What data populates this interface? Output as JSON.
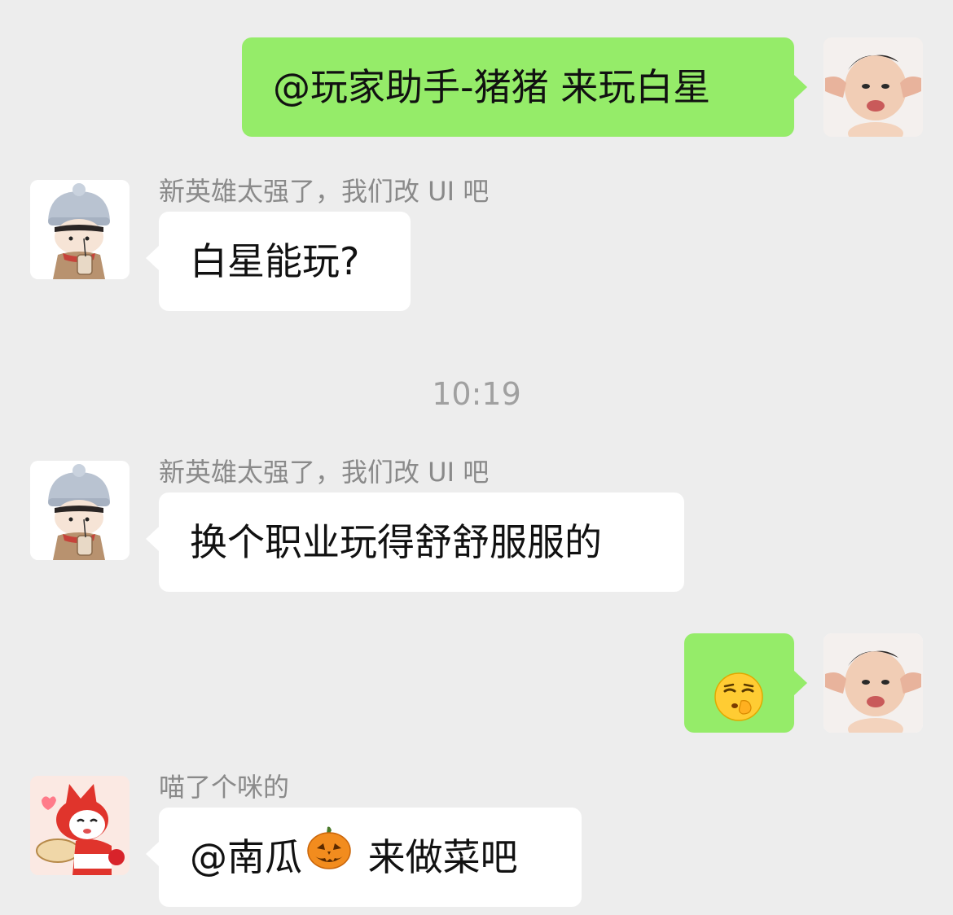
{
  "messages": [
    {
      "direction": "out",
      "text": "@玩家助手-猪猪 来玩白星",
      "avatar": "baby-photo-avatar"
    },
    {
      "direction": "in",
      "sender": "新英雄太强了，我们改 UI 吧",
      "text": "白星能玩?",
      "avatar": "cartoon-girl-avatar"
    },
    {
      "direction": "in",
      "sender": "新英雄太强了，我们改 UI 吧",
      "text": "换个职业玩得舒舒服服的",
      "avatar": "cartoon-girl-avatar"
    },
    {
      "direction": "out",
      "emoji": "shushing-face-emoji",
      "avatar": "baby-photo-avatar"
    },
    {
      "direction": "in",
      "sender": "喵了个咪的",
      "text_before": "@南瓜",
      "emoji": "jack-o-lantern-emoji",
      "text_after": " 来做菜吧",
      "avatar": "red-cat-avatar"
    }
  ],
  "timestamp": "10:19",
  "colors": {
    "background": "#EDEDED",
    "outgoing_bubble": "#95EC69",
    "incoming_bubble": "#FFFFFF",
    "sender_text": "#8a8a8a",
    "timestamp_text": "#a0a0a0"
  }
}
